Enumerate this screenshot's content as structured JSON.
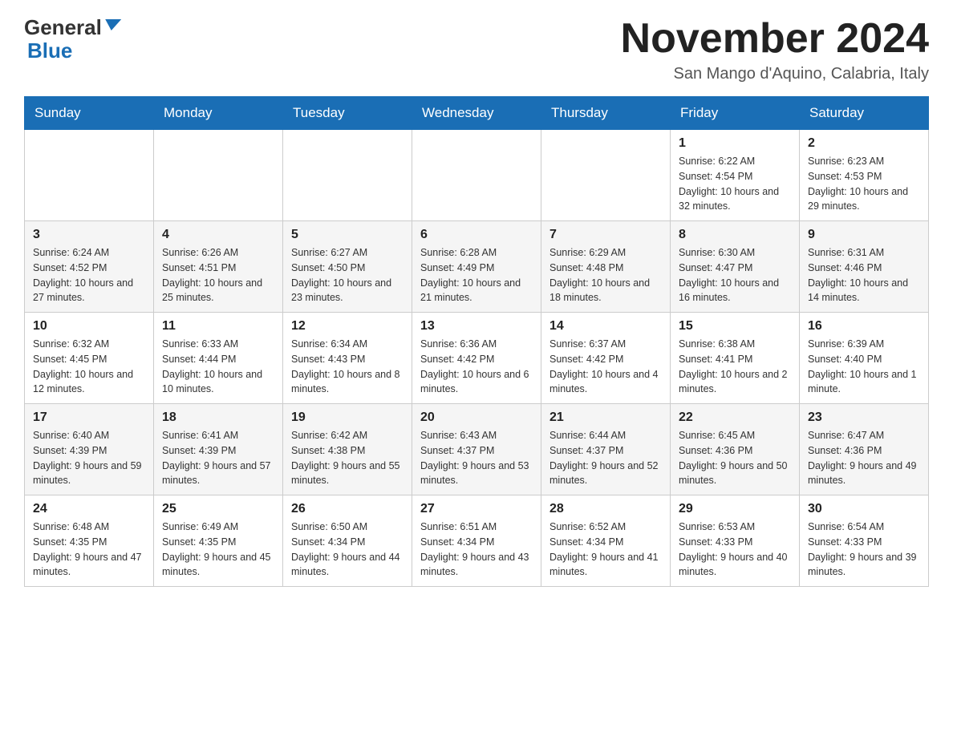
{
  "header": {
    "logo_line1": "General",
    "logo_line2": "Blue",
    "month_title": "November 2024",
    "subtitle": "San Mango d'Aquino, Calabria, Italy"
  },
  "weekdays": [
    "Sunday",
    "Monday",
    "Tuesday",
    "Wednesday",
    "Thursday",
    "Friday",
    "Saturday"
  ],
  "weeks": [
    [
      {
        "day": "",
        "info": ""
      },
      {
        "day": "",
        "info": ""
      },
      {
        "day": "",
        "info": ""
      },
      {
        "day": "",
        "info": ""
      },
      {
        "day": "",
        "info": ""
      },
      {
        "day": "1",
        "info": "Sunrise: 6:22 AM\nSunset: 4:54 PM\nDaylight: 10 hours and 32 minutes."
      },
      {
        "day": "2",
        "info": "Sunrise: 6:23 AM\nSunset: 4:53 PM\nDaylight: 10 hours and 29 minutes."
      }
    ],
    [
      {
        "day": "3",
        "info": "Sunrise: 6:24 AM\nSunset: 4:52 PM\nDaylight: 10 hours and 27 minutes."
      },
      {
        "day": "4",
        "info": "Sunrise: 6:26 AM\nSunset: 4:51 PM\nDaylight: 10 hours and 25 minutes."
      },
      {
        "day": "5",
        "info": "Sunrise: 6:27 AM\nSunset: 4:50 PM\nDaylight: 10 hours and 23 minutes."
      },
      {
        "day": "6",
        "info": "Sunrise: 6:28 AM\nSunset: 4:49 PM\nDaylight: 10 hours and 21 minutes."
      },
      {
        "day": "7",
        "info": "Sunrise: 6:29 AM\nSunset: 4:48 PM\nDaylight: 10 hours and 18 minutes."
      },
      {
        "day": "8",
        "info": "Sunrise: 6:30 AM\nSunset: 4:47 PM\nDaylight: 10 hours and 16 minutes."
      },
      {
        "day": "9",
        "info": "Sunrise: 6:31 AM\nSunset: 4:46 PM\nDaylight: 10 hours and 14 minutes."
      }
    ],
    [
      {
        "day": "10",
        "info": "Sunrise: 6:32 AM\nSunset: 4:45 PM\nDaylight: 10 hours and 12 minutes."
      },
      {
        "day": "11",
        "info": "Sunrise: 6:33 AM\nSunset: 4:44 PM\nDaylight: 10 hours and 10 minutes."
      },
      {
        "day": "12",
        "info": "Sunrise: 6:34 AM\nSunset: 4:43 PM\nDaylight: 10 hours and 8 minutes."
      },
      {
        "day": "13",
        "info": "Sunrise: 6:36 AM\nSunset: 4:42 PM\nDaylight: 10 hours and 6 minutes."
      },
      {
        "day": "14",
        "info": "Sunrise: 6:37 AM\nSunset: 4:42 PM\nDaylight: 10 hours and 4 minutes."
      },
      {
        "day": "15",
        "info": "Sunrise: 6:38 AM\nSunset: 4:41 PM\nDaylight: 10 hours and 2 minutes."
      },
      {
        "day": "16",
        "info": "Sunrise: 6:39 AM\nSunset: 4:40 PM\nDaylight: 10 hours and 1 minute."
      }
    ],
    [
      {
        "day": "17",
        "info": "Sunrise: 6:40 AM\nSunset: 4:39 PM\nDaylight: 9 hours and 59 minutes."
      },
      {
        "day": "18",
        "info": "Sunrise: 6:41 AM\nSunset: 4:39 PM\nDaylight: 9 hours and 57 minutes."
      },
      {
        "day": "19",
        "info": "Sunrise: 6:42 AM\nSunset: 4:38 PM\nDaylight: 9 hours and 55 minutes."
      },
      {
        "day": "20",
        "info": "Sunrise: 6:43 AM\nSunset: 4:37 PM\nDaylight: 9 hours and 53 minutes."
      },
      {
        "day": "21",
        "info": "Sunrise: 6:44 AM\nSunset: 4:37 PM\nDaylight: 9 hours and 52 minutes."
      },
      {
        "day": "22",
        "info": "Sunrise: 6:45 AM\nSunset: 4:36 PM\nDaylight: 9 hours and 50 minutes."
      },
      {
        "day": "23",
        "info": "Sunrise: 6:47 AM\nSunset: 4:36 PM\nDaylight: 9 hours and 49 minutes."
      }
    ],
    [
      {
        "day": "24",
        "info": "Sunrise: 6:48 AM\nSunset: 4:35 PM\nDaylight: 9 hours and 47 minutes."
      },
      {
        "day": "25",
        "info": "Sunrise: 6:49 AM\nSunset: 4:35 PM\nDaylight: 9 hours and 45 minutes."
      },
      {
        "day": "26",
        "info": "Sunrise: 6:50 AM\nSunset: 4:34 PM\nDaylight: 9 hours and 44 minutes."
      },
      {
        "day": "27",
        "info": "Sunrise: 6:51 AM\nSunset: 4:34 PM\nDaylight: 9 hours and 43 minutes."
      },
      {
        "day": "28",
        "info": "Sunrise: 6:52 AM\nSunset: 4:34 PM\nDaylight: 9 hours and 41 minutes."
      },
      {
        "day": "29",
        "info": "Sunrise: 6:53 AM\nSunset: 4:33 PM\nDaylight: 9 hours and 40 minutes."
      },
      {
        "day": "30",
        "info": "Sunrise: 6:54 AM\nSunset: 4:33 PM\nDaylight: 9 hours and 39 minutes."
      }
    ]
  ]
}
